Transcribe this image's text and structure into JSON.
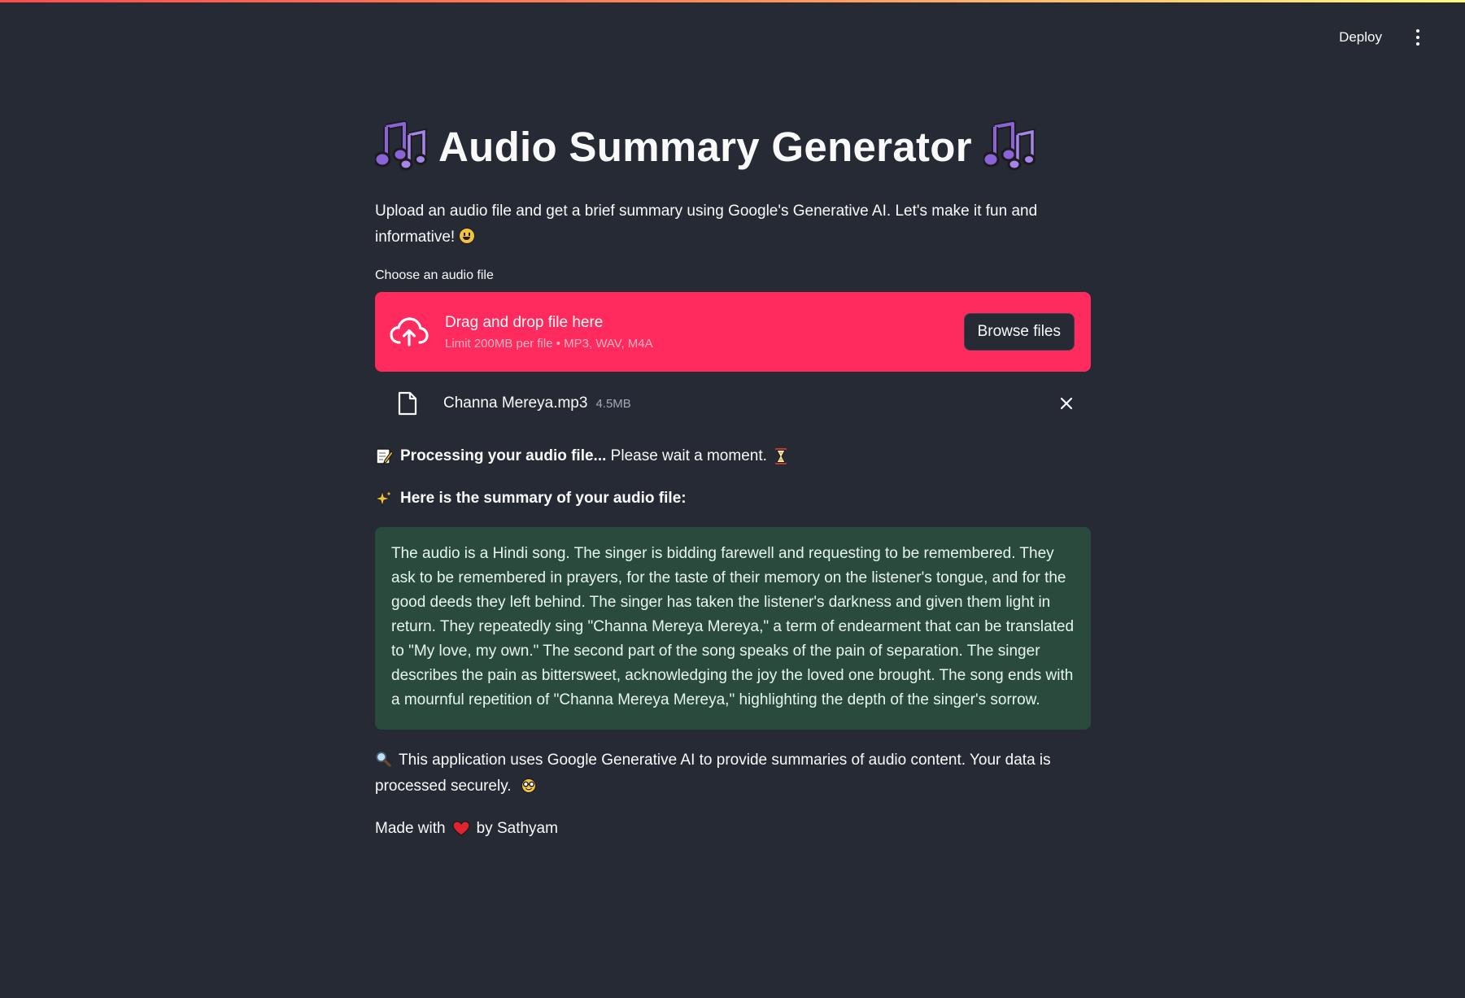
{
  "header": {
    "deploy_label": "Deploy",
    "menu_icon": "vertical-dots-icon"
  },
  "main": {
    "title": "Audio Summary Generator",
    "title_icon": "musical-notes-icon",
    "intro": "Upload an audio file and get a brief summary using Google's Generative AI. Let's make it fun and informative!",
    "uploader": {
      "label": "Choose an audio file",
      "drop_text": "Drag and drop file here",
      "limit_text": "Limit 200MB per file • MP3, WAV, M4A",
      "browse_label": "Browse files",
      "file": {
        "name": "Channa Mereya.mp3",
        "size": "4.5MB"
      }
    },
    "processing": {
      "bold_text": "Processing your audio file...",
      "rest_text": " Please wait a moment."
    },
    "summary_heading": "Here is the summary of your audio file:",
    "summary_text": "The audio is a Hindi song. The singer is bidding farewell and requesting to be remembered. They ask to be remembered in prayers, for the taste of their memory on the listener's tongue, and for the good deeds they left behind. The singer has taken the listener's darkness and given them light in return. They repeatedly sing \"Channa Mereya Mereya,\" a term of endearment that can be translated to \"My love, my own.\" The second part of the song speaks of the pain of separation. The singer describes the pain as bittersweet, acknowledging the joy the loved one brought. The song ends with a mournful repetition of \"Channa Mereya Mereya,\" highlighting the depth of the singer's sorrow.",
    "footer_note": "This application uses Google Generative AI to provide summaries of audio content. Your data is processed securely.",
    "made_with_prefix": "Made with",
    "made_with_suffix": "by Sathyam"
  },
  "colors": {
    "background": "#262a34",
    "dropzone": "#ff2b5e",
    "summary_box": "#2a4a3e",
    "text": "#fafafa"
  }
}
